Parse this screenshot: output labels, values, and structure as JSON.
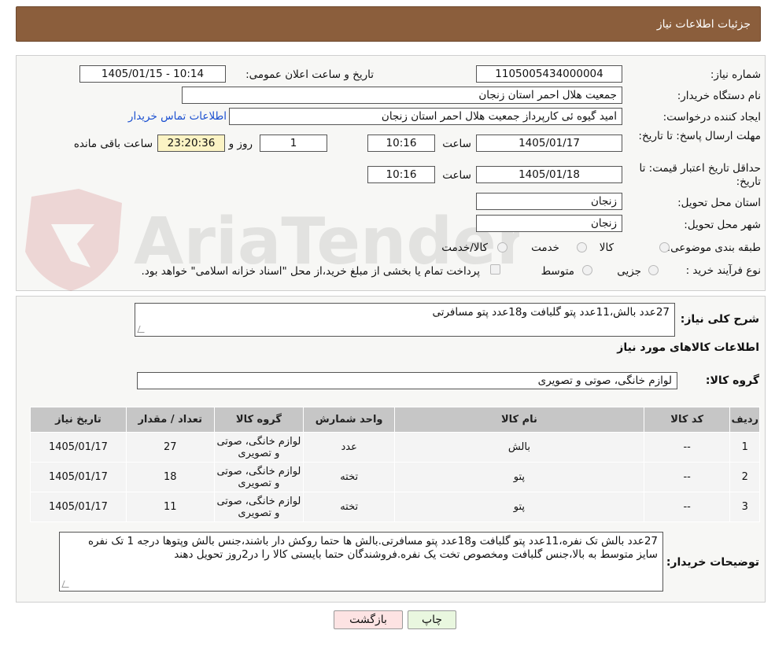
{
  "header": {
    "title": "جزئیات اطلاعات نیاز"
  },
  "watermark": {
    "text": "AriaTender.neT"
  },
  "form": {
    "need_number_label": "شماره نیاز:",
    "need_number": "1105005434000004",
    "announce_label": "تاریخ و ساعت اعلان عمومی:",
    "announce_value": "1405/01/15 - 10:14",
    "buyer_org_label": "نام دستگاه خریدار:",
    "buyer_org": "جمعیت هلال احمر استان زنجان",
    "requester_label": "ایجاد کننده درخواست:",
    "requester": "امید گیوه ئی کارپرداز  جمعیت هلال احمر استان زنجان",
    "contact_link": "اطلاعات تماس خریدار",
    "deadline_label": "مهلت ارسال پاسخ: تا تاریخ:",
    "deadline_date": "1405/01/17",
    "time_label": "ساعت",
    "deadline_time": "10:16",
    "days": "1",
    "days_label": "روز و",
    "remaining": "23:20:36",
    "remaining_label": "ساعت باقی مانده",
    "validity_label": "حداقل تاریخ اعتبار قیمت: تا تاریخ:",
    "validity_date": "1405/01/18",
    "validity_time": "10:16",
    "province_label": "استان محل تحویل:",
    "province": "زنجان",
    "city_label": "شهر محل تحویل:",
    "city": "زنجان",
    "category_label": "طبقه بندی موضوعی:",
    "category_options": [
      "کالا",
      "خدمت",
      "کالا/خدمت"
    ],
    "process_label": "نوع فرآیند خرید :",
    "process_options": [
      "جزیی",
      "متوسط"
    ],
    "treasury_text": "پرداخت تمام یا بخشی از مبلغ خرید،از محل \"اسناد خزانه اسلامی\" خواهد بود."
  },
  "details": {
    "summary_label": "شرح کلی نیاز:",
    "summary": "27عدد بالش،11عدد پتو گلبافت و18عدد پتو مسافرتی",
    "goods_info_title": "اطلاعات کالاهای مورد نیاز",
    "goods_group_label": "گروه کالا:",
    "goods_group": "لوازم خانگی، صوتی و تصویری",
    "table": {
      "headers": [
        "ردیف",
        "کد کالا",
        "نام کالا",
        "واحد شمارش",
        "گروه کالا",
        "تعداد / مقدار",
        "تاریخ نیاز"
      ],
      "rows": [
        [
          "1",
          "--",
          "بالش",
          "عدد",
          "لوازم خانگی، صوتی و تصویری",
          "27",
          "1405/01/17"
        ],
        [
          "2",
          "--",
          "پتو",
          "تخته",
          "لوازم خانگی، صوتی و تصویری",
          "18",
          "1405/01/17"
        ],
        [
          "3",
          "--",
          "پتو",
          "تخته",
          "لوازم خانگی، صوتی و تصویری",
          "11",
          "1405/01/17"
        ]
      ]
    },
    "buyer_notes_label": "توضیحات خریدار:",
    "buyer_notes": "27عدد بالش تک نفره،11عدد پتو گلبافت و18عدد پتو مسافرتی.بالش ها حتما روکش دار باشند،جنس بالش وپتوها درجه 1 تک نفره سایز متوسط به بالا،جنس گلبافت ومخصوص تخت یک نفره.فروشندگان حتما بایستی کالا را در2روز تحویل دهند"
  },
  "buttons": {
    "print": "چاپ",
    "back": "بازگشت"
  },
  "colors": {
    "header": "#8b5e3c",
    "print_btn": "#e9f7df",
    "back_btn": "#fde3e3",
    "link": "#1a4fd0"
  }
}
